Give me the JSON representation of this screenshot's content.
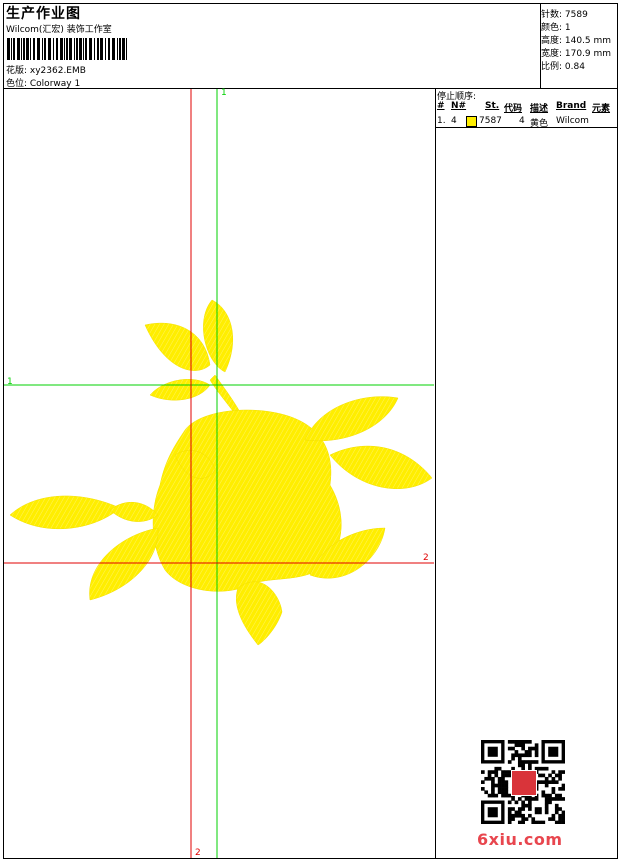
{
  "header": {
    "title": "生产作业图",
    "subtitle": "Wilcom(汇宏) 装饰工作室",
    "design_label": "花版: xy2362.EMB",
    "colorway_label": "色位: Colorway 1"
  },
  "stats": [
    "针数: 7589",
    "颜色: 1",
    "高度: 140.5 mm",
    "宽度: 170.9 mm",
    "比例: 0.84"
  ],
  "stop_sequence": {
    "title": "停止顺序:",
    "columns": [
      "#",
      "N#",
      "St.",
      "代码",
      "描述",
      "Brand",
      "元素"
    ],
    "rows": [
      {
        "num": "1.",
        "needle": "4",
        "swatch_color": "#ffee00",
        "stitches": "7587",
        "code": "4",
        "description": "黄色",
        "brand": "Wilcom"
      }
    ]
  },
  "axes": {
    "green_v": "1",
    "green_h": "1",
    "red_h": "2",
    "red_v": "2",
    "green_color": "#00d000",
    "red_color": "#e00000"
  },
  "design": {
    "fill_color": "#ffee00"
  },
  "watermark": {
    "brand": "6xiu.com",
    "brand_color": "#e8464e"
  }
}
